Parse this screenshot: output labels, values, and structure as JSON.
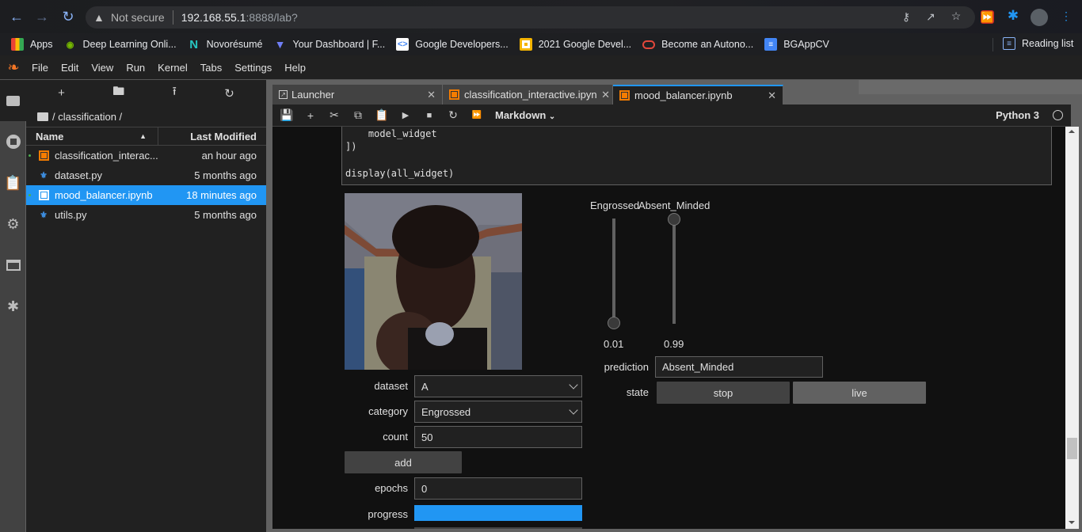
{
  "browser": {
    "security_label": "Not secure",
    "url_host": "192.168.55.1",
    "url_path": ":8888/lab?",
    "bookmarks": [
      {
        "label": "Apps",
        "icon": "apps-grid-icon"
      },
      {
        "label": "Deep Learning Onli...",
        "icon": "nvidia-icon"
      },
      {
        "label": "Novorésumé",
        "icon": "novoresume-icon"
      },
      {
        "label": "Your Dashboard | F...",
        "icon": "dashboard-icon"
      },
      {
        "label": "Google Developers...",
        "icon": "google-developers-icon"
      },
      {
        "label": "2021 Google Devel...",
        "icon": "slides-icon"
      },
      {
        "label": "Become an Autono...",
        "icon": "oracle-icon"
      },
      {
        "label": "BGAppCV",
        "icon": "docs-icon"
      }
    ],
    "reading_list": "Reading list"
  },
  "menubar": {
    "items": [
      "File",
      "Edit",
      "View",
      "Run",
      "Kernel",
      "Tabs",
      "Settings",
      "Help"
    ]
  },
  "filebrowser": {
    "breadcrumb": "/ classification /",
    "columns": {
      "name": "Name",
      "modified": "Last Modified"
    },
    "files": [
      {
        "name": "classification_interac...",
        "modified": "an hour ago",
        "type": "notebook",
        "running": true,
        "selected": false
      },
      {
        "name": "dataset.py",
        "modified": "5 months ago",
        "type": "python",
        "running": false,
        "selected": false
      },
      {
        "name": "mood_balancer.ipynb",
        "modified": "18 minutes ago",
        "type": "notebook",
        "running": true,
        "selected": true
      },
      {
        "name": "utils.py",
        "modified": "5 months ago",
        "type": "python",
        "running": false,
        "selected": false
      }
    ]
  },
  "tabs": [
    {
      "label": "Launcher",
      "active": false
    },
    {
      "label": "classification_interactive.ipyn",
      "active": false
    },
    {
      "label": "mood_balancer.ipynb",
      "active": true
    }
  ],
  "notebook_toolbar": {
    "cell_type": "Markdown",
    "kernel": "Python 3"
  },
  "code_cell": {
    "lines": [
      "    model_widget",
      "])",
      "",
      "display(all_widget)"
    ]
  },
  "widgets": {
    "sliders": [
      {
        "label": "Engrossed",
        "value": 0.01,
        "value_text": "0.01"
      },
      {
        "label": "Absent_Minded",
        "value": 0.99,
        "value_text": "0.99"
      }
    ],
    "prediction": {
      "label": "prediction",
      "value": "Absent_Minded"
    },
    "state": {
      "label": "state",
      "buttons": [
        "stop",
        "live"
      ]
    },
    "dataset": {
      "label": "dataset",
      "value": "A"
    },
    "category": {
      "label": "category",
      "value": "Engrossed"
    },
    "count": {
      "label": "count",
      "value": "50"
    },
    "add_button": "add",
    "epochs": {
      "label": "epochs",
      "value": "0"
    },
    "progress": {
      "label": "progress",
      "value": 1.0
    },
    "accent_color": "#2196f3"
  }
}
